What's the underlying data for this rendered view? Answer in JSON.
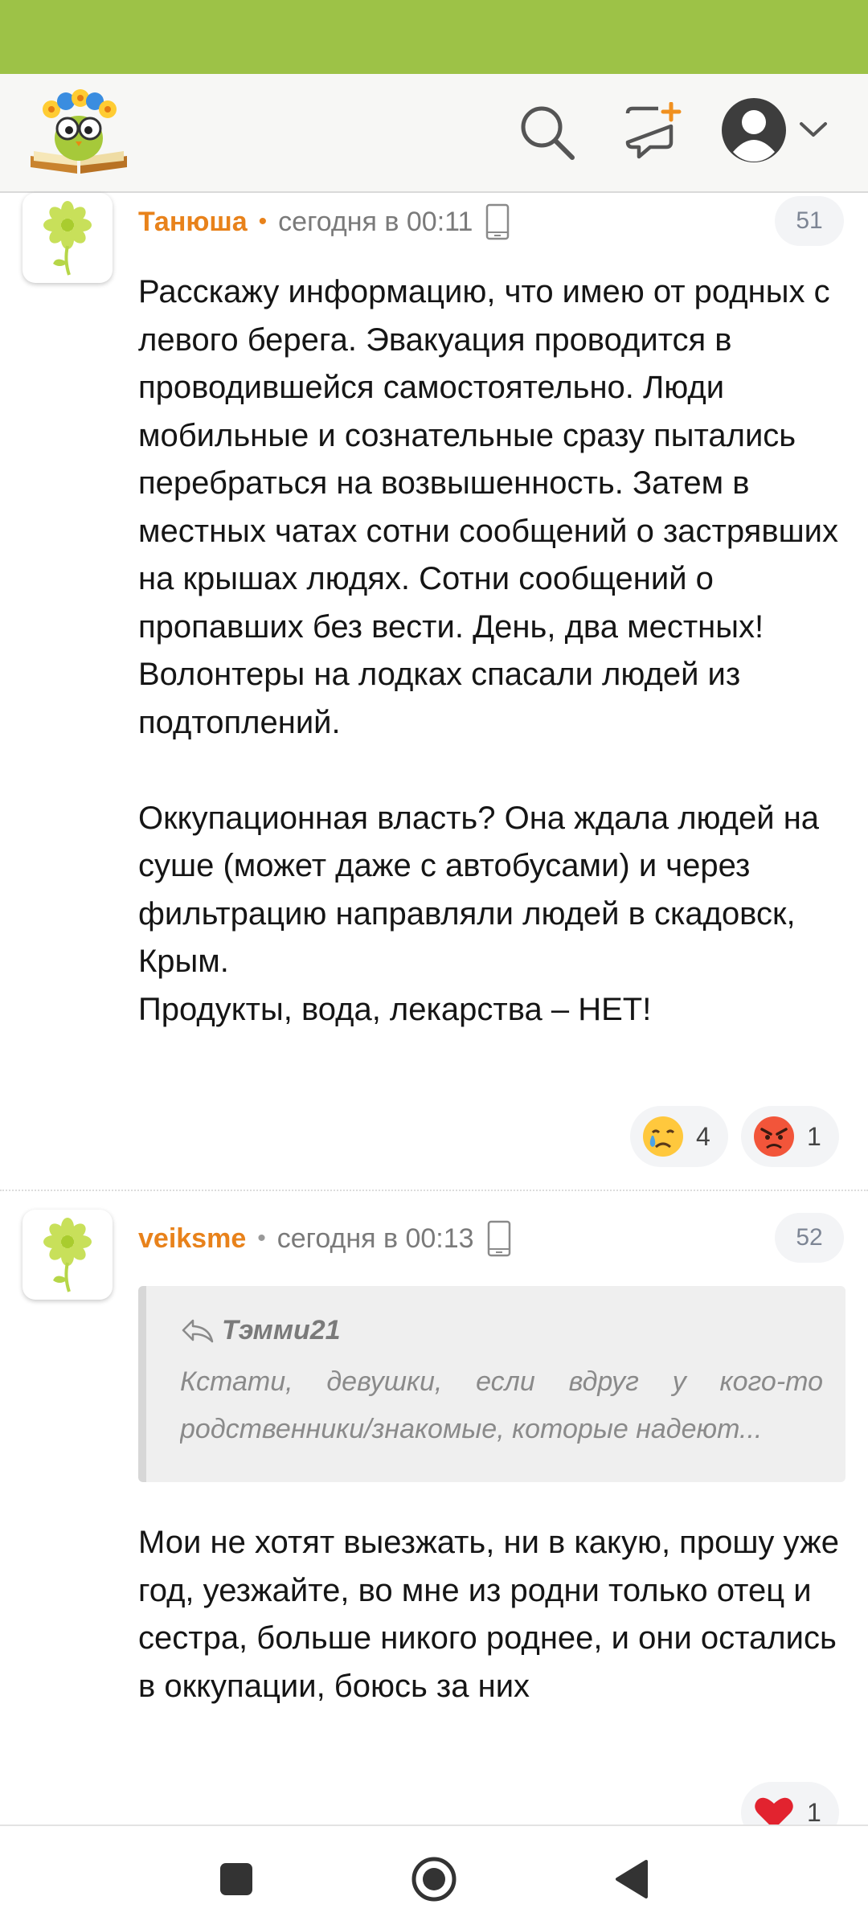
{
  "theme": {
    "status_bar_color": "#9dc247",
    "accent_color": "#e8821b"
  },
  "header": {
    "logo_icon": "owl-with-flowers-logo",
    "icons": [
      "search-icon",
      "new-message-icon",
      "profile-avatar-icon",
      "chevron-down-icon"
    ]
  },
  "comments": [
    {
      "author": "Танюша",
      "dot": "•",
      "time": "сегодня в 00:11",
      "device_icon": "mobile-device-icon",
      "number": "51",
      "paragraphs": [
        "Расскажу информацию, что имею от родных с левого берега. Эвакуация проводится в проводившейся самостоятельно. Люди мобильные и сознательные сразу пытались перебраться на возвышенность. Затем в местных чатах сотни сообщений о застрявших на крышах людях. Сотни сообщений о пропавших без вести. День, два местных! Волонтеры на лодках спасали людей из подтоплений.",
        "Оккупационная власть? Она ждала людей на суше (может даже с автобусами) и через фильтрацию направляли людей в скадовск, Крым.\nПродукты, вода, лекарства – НЕТ!"
      ],
      "reactions": [
        {
          "emoji": "crying-face-emoji",
          "count": "4"
        },
        {
          "emoji": "angry-face-emoji",
          "count": "1"
        }
      ]
    },
    {
      "author": "veiksme",
      "dot": "•",
      "time": "сегодня в 00:13",
      "device_icon": "mobile-device-icon",
      "number": "52",
      "quote": {
        "icon": "reply-arrow-icon",
        "author": "Тэмми21",
        "line1": "Кстати, девушки, если вдруг у кого-то",
        "line2": "родственники/знакомые, которые надеют..."
      },
      "paragraphs": [
        "Мои не хотят выезжать, ни в какую, прошу уже год, уезжайте, во мне из родни только отец и сестра, больше никого роднее, и они остались в оккупации, боюсь за них"
      ],
      "reactions": [
        {
          "emoji": "red-heart-emoji",
          "count": "1"
        }
      ]
    }
  ],
  "nav": {
    "buttons": [
      "recent-apps-button",
      "home-button",
      "back-button"
    ]
  }
}
